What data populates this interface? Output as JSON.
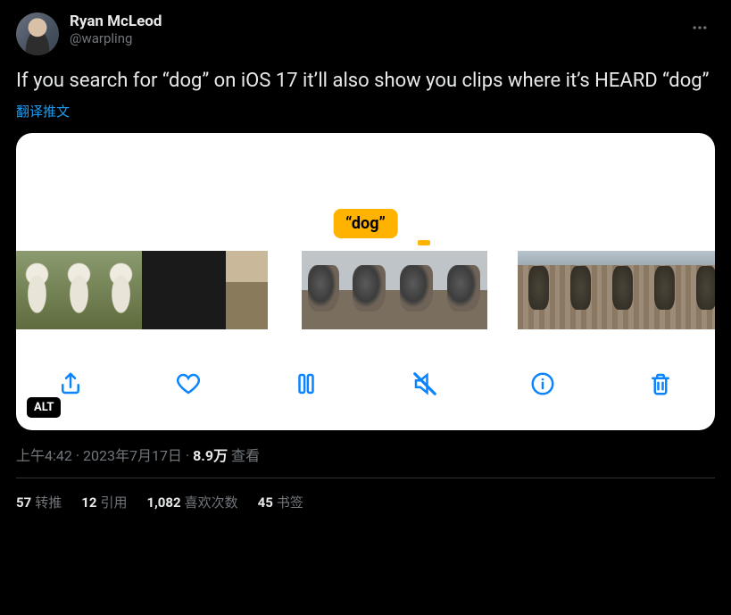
{
  "author": {
    "display_name": "Ryan McLeod",
    "handle": "@warpling"
  },
  "tweet_text": "If you search for “dog” on iOS 17 it’ll also show you clips where it’s HEARD “dog”",
  "translate_label": "翻译推文",
  "media": {
    "caption_text": "“dog”",
    "alt_badge": "ALT",
    "toolbar_icons": [
      "share",
      "heart",
      "pause",
      "mute",
      "info",
      "trash"
    ]
  },
  "meta": {
    "time": "上午4:42",
    "separator": " · ",
    "date": "2023年7月17日",
    "views_number": "8.9万",
    "views_label": " 查看"
  },
  "stats": {
    "retweets": {
      "count": "57",
      "label": "转推"
    },
    "quotes": {
      "count": "12",
      "label": "引用"
    },
    "likes": {
      "count": "1,082",
      "label": "喜欢次数"
    },
    "bookmarks": {
      "count": "45",
      "label": "书签"
    }
  }
}
